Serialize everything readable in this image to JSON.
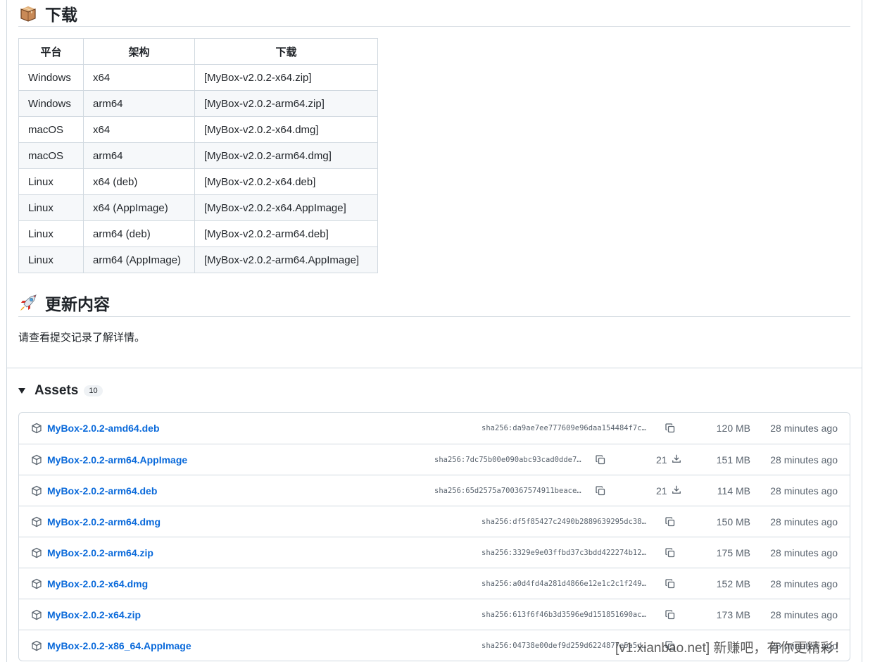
{
  "download_section": {
    "heading": "下载",
    "table": {
      "headers": [
        "平台",
        "架构",
        "下载"
      ],
      "rows": [
        [
          "Windows",
          "x64",
          "[MyBox-v2.0.2-x64.zip]"
        ],
        [
          "Windows",
          "arm64",
          "[MyBox-v2.0.2-arm64.zip]"
        ],
        [
          "macOS",
          "x64",
          "[MyBox-v2.0.2-x64.dmg]"
        ],
        [
          "macOS",
          "arm64",
          "[MyBox-v2.0.2-arm64.dmg]"
        ],
        [
          "Linux",
          "x64 (deb)",
          "[MyBox-v2.0.2-x64.deb]"
        ],
        [
          "Linux",
          "x64 (AppImage)",
          "[MyBox-v2.0.2-x64.AppImage]"
        ],
        [
          "Linux",
          "arm64 (deb)",
          "[MyBox-v2.0.2-arm64.deb]"
        ],
        [
          "Linux",
          "arm64 (AppImage)",
          "[MyBox-v2.0.2-arm64.AppImage]"
        ]
      ]
    }
  },
  "updates_section": {
    "heading": "更新内容",
    "text": "请查看提交记录了解详情。"
  },
  "assets": {
    "title": "Assets",
    "count": "10",
    "items": [
      {
        "name": "MyBox-2.0.2-amd64.deb",
        "sha": "sha256:da9ae7ee777609e96daa154484f7c…",
        "downloads": "",
        "size": "120 MB",
        "time": "28 minutes ago"
      },
      {
        "name": "MyBox-2.0.2-arm64.AppImage",
        "sha": "sha256:7dc75b00e090abc93cad0dde7…",
        "downloads": "21",
        "size": "151 MB",
        "time": "28 minutes ago"
      },
      {
        "name": "MyBox-2.0.2-arm64.deb",
        "sha": "sha256:65d2575a700367574911beace…",
        "downloads": "21",
        "size": "114 MB",
        "time": "28 minutes ago"
      },
      {
        "name": "MyBox-2.0.2-arm64.dmg",
        "sha": "sha256:df5f85427c2490b2889639295dc38…",
        "downloads": "",
        "size": "150 MB",
        "time": "28 minutes ago"
      },
      {
        "name": "MyBox-2.0.2-arm64.zip",
        "sha": "sha256:3329e9e03ffbd37c3bdd422274b12…",
        "downloads": "",
        "size": "175 MB",
        "time": "28 minutes ago"
      },
      {
        "name": "MyBox-2.0.2-x64.dmg",
        "sha": "sha256:a0d4fd4a281d4866e12e1c2c1f249…",
        "downloads": "",
        "size": "152 MB",
        "time": "28 minutes ago"
      },
      {
        "name": "MyBox-2.0.2-x64.zip",
        "sha": "sha256:613f6f46b3d3596e9d151851690ac…",
        "downloads": "",
        "size": "173 MB",
        "time": "28 minutes ago"
      },
      {
        "name": "MyBox-2.0.2-x86_64.AppImage",
        "sha": "sha256:04738e00def9d259d6224877e5a5d…",
        "downloads": "",
        "size": "",
        "time": "28 minutes ago"
      }
    ]
  },
  "watermark": "[v1.xianbao.net] 新赚吧，有你更精彩！",
  "colors": {
    "link": "#0969da",
    "muted": "#59636e",
    "border": "#d1d9e0"
  }
}
